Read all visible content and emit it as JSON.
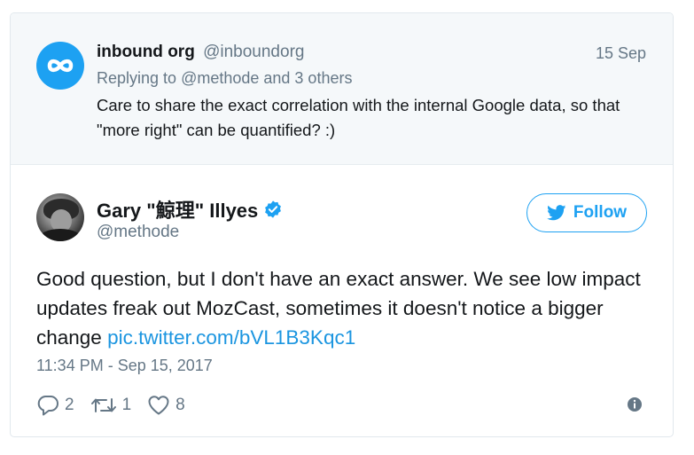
{
  "parent_tweet": {
    "name": "inbound org",
    "handle": "@inboundorg",
    "date": "15 Sep",
    "replying_prefix": "Replying to ",
    "replying_mention": "@methode",
    "replying_suffix": " and 3 others",
    "text": "Care to share the exact correlation with the internal Google data, so that \"more right\" can be quantified? :)",
    "avatar_icon": "infinity-logo-icon"
  },
  "main_tweet": {
    "name": "Gary \"鯨理\" Illyes",
    "verified_icon": "verified-badge-icon",
    "handle": "@methode",
    "follow_label": "Follow",
    "text_before_link": "Good question, but I don't have an exact answer. We see low impact updates freak out MozCast, sometimes it doesn't notice a bigger change ",
    "link_text": "pic.twitter.com/bVL1B3Kqc1",
    "timestamp": "11:34 PM - Sep 15, 2017",
    "actions": {
      "reply_count": "2",
      "retweet_count": "1",
      "like_count": "8"
    }
  },
  "colors": {
    "accent": "#1da1f2",
    "link": "#1b95e0",
    "muted": "#657786",
    "parent_bg": "#f5f8fa"
  }
}
